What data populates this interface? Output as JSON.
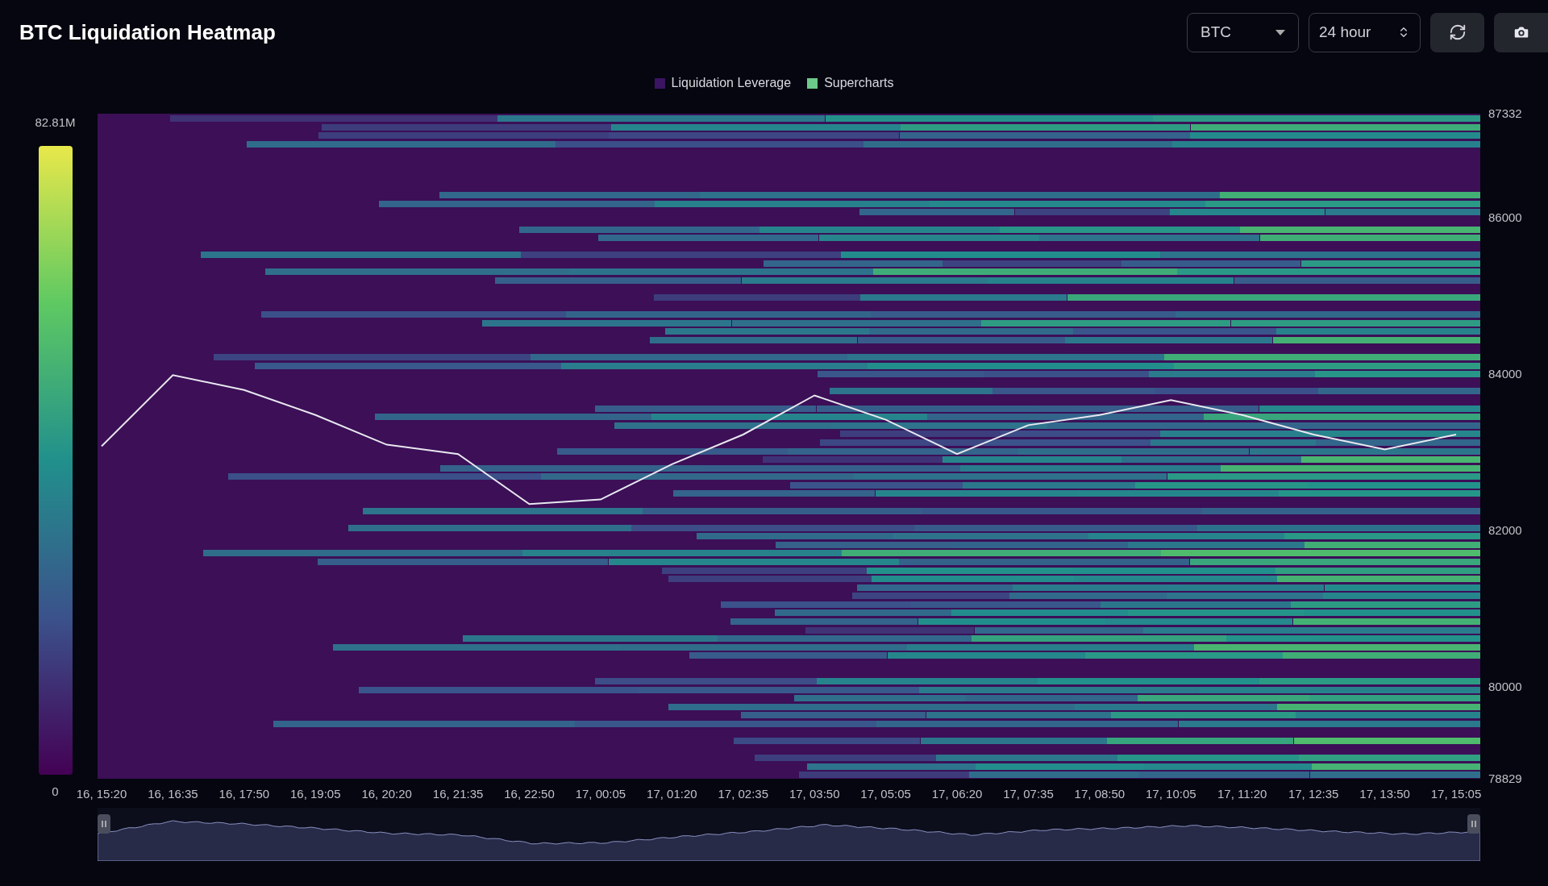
{
  "header": {
    "title": "BTC Liquidation Heatmap",
    "symbol_select": {
      "value": "BTC"
    },
    "range_select": {
      "value": "24 hour"
    }
  },
  "legend": [
    {
      "label": "Liquidation Leverage",
      "color": "#3b1462"
    },
    {
      "label": "Supercharts",
      "color": "#6cc98a"
    }
  ],
  "color_scale": {
    "max_label": "82.81M",
    "min_label": "0"
  },
  "chart_data": {
    "type": "line",
    "categories": [
      "16, 15:20",
      "16, 16:35",
      "16, 17:50",
      "16, 19:05",
      "16, 20:20",
      "16, 21:35",
      "16, 22:50",
      "17, 00:05",
      "17, 01:20",
      "17, 02:35",
      "17, 03:50",
      "17, 05:05",
      "17, 06:20",
      "17, 07:35",
      "17, 08:50",
      "17, 10:05",
      "17, 11:20",
      "17, 12:35",
      "17, 13:50",
      "17, 15:05"
    ],
    "series": [
      {
        "color": "#e8e8f0",
        "values": [
          83080,
          83990,
          83800,
          83480,
          83100,
          82980,
          82340,
          82400,
          82850,
          83230,
          83730,
          83420,
          82980,
          83350,
          83480,
          83670,
          83480,
          83230,
          83040,
          83230
        ]
      }
    ],
    "ylim": [
      78829,
      87332
    ],
    "yticks": [
      78829,
      80000,
      82000,
      84000,
      86000,
      87332
    ]
  }
}
